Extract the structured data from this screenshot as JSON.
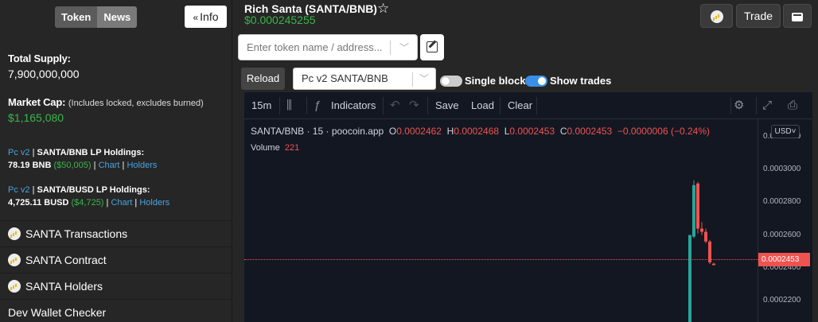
{
  "sidebar": {
    "tabs": [
      "Token",
      "News"
    ],
    "info_button": "Info",
    "total_supply": {
      "label": "Total Supply:",
      "value": "7,900,000,000"
    },
    "market_cap": {
      "label": "Market Cap:",
      "note": "(Includes locked, excludes burned)",
      "value": "$1,165,080"
    },
    "lp_bnb": {
      "source": "Pc v2",
      "title": "SANTA/BNB LP Holdings:",
      "amount": "78.19 BNB",
      "usd": "($50,005)",
      "chart_link": "Chart",
      "holders_link": "Holders"
    },
    "lp_busd": {
      "source": "Pc v2",
      "title": "SANTA/BUSD LP Holdings:",
      "amount": "4,725.11 BUSD",
      "usd": "($4,725)",
      "chart_link": "Chart",
      "holders_link": "Holders"
    },
    "menu": [
      "SANTA Transactions",
      "SANTA Contract",
      "SANTA Holders",
      "Dev Wallet Checker"
    ]
  },
  "header": {
    "title": "Rich Santa (SANTA/BNB)",
    "price": "$0.000245255",
    "trade_label": "Trade"
  },
  "search": {
    "placeholder": "Enter token name / address..."
  },
  "controls": {
    "reload_label": "Reload",
    "pair_value": "Pc v2 SANTA/BNB",
    "single_blocks_label": "Single blocks",
    "show_trades_label": "Show trades",
    "single_blocks_on": false,
    "show_trades_on": true
  },
  "chart": {
    "toolbar": {
      "interval": "15m",
      "indicators": "Indicators",
      "save": "Save",
      "load": "Load",
      "clear": "Clear"
    },
    "legend": {
      "symbol": "SANTA/BNB",
      "interval": "15",
      "source": "poocoin.app",
      "o_label": "O",
      "o_value": "0.0002462",
      "h_label": "H",
      "h_value": "0.0002468",
      "l_label": "L",
      "l_value": "0.0002453",
      "c_label": "C",
      "c_value": "0.0002453",
      "change": "−0.0000006 (−0.24%)"
    },
    "volume_label": "Volume",
    "volume_value": "221",
    "currency": "USD",
    "y_ticks": [
      "0.0003200",
      "0.0003000",
      "0.0002800",
      "0.0002600",
      "0.0002400",
      "0.0002200"
    ],
    "last_price": "0.0002453",
    "colors": {
      "up": "#26a69a",
      "down": "#ef5350",
      "background": "#131722"
    }
  },
  "chart_data": {
    "type": "candlestick",
    "ylim": [
      0.00021,
      0.000328
    ],
    "candles": [
      {
        "o": 0.00021,
        "h": 0.000264,
        "l": 0.00021,
        "c": 0.000264
      },
      {
        "o": 0.000263,
        "h": 0.000298,
        "l": 0.000262,
        "c": 0.000295
      },
      {
        "o": 0.000296,
        "h": 0.000297,
        "l": 0.000265,
        "c": 0.000268
      },
      {
        "o": 0.000268,
        "h": 0.000272,
        "l": 0.000264,
        "c": 0.000266
      },
      {
        "o": 0.000266,
        "h": 0.000268,
        "l": 0.000259,
        "c": 0.00026
      },
      {
        "o": 0.00026,
        "h": 0.000261,
        "l": 0.000246,
        "c": 0.000247
      },
      {
        "o": 0.0002462,
        "h": 0.0002468,
        "l": 0.0002453,
        "c": 0.0002453
      }
    ]
  }
}
